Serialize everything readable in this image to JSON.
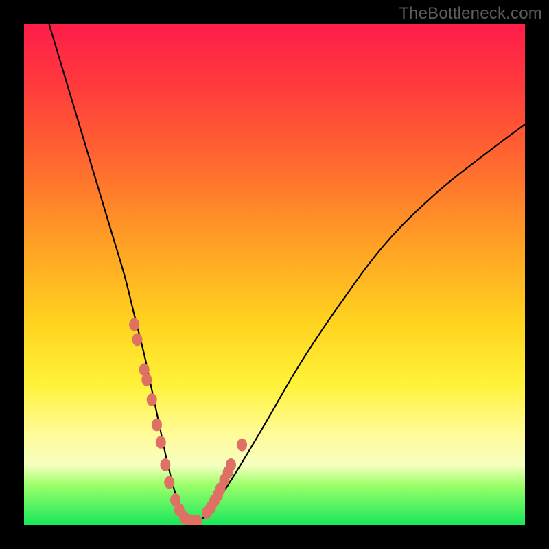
{
  "watermark": "TheBottleneck.com",
  "chart_data": {
    "type": "line",
    "title": "",
    "xlabel": "",
    "ylabel": "",
    "xlim": [
      0,
      100
    ],
    "ylim": [
      0,
      100
    ],
    "grid": false,
    "legend": false,
    "series": [
      {
        "name": "bottleneck-curve",
        "x": [
          5,
          8,
          11,
          14,
          17,
          20,
          22,
          24,
          25.5,
          27,
          28.5,
          30,
          31.5,
          33,
          35,
          38,
          42,
          48,
          55,
          63,
          72,
          82,
          92,
          100
        ],
        "y": [
          100,
          90,
          80,
          70,
          60,
          50,
          42,
          34,
          27,
          20,
          13,
          7,
          3,
          0.8,
          0.8,
          4,
          10,
          20,
          32,
          44,
          56,
          66,
          74,
          80
        ]
      }
    ],
    "markers": {
      "name": "highlight-points",
      "comment": "salmon dots clustered near the minimum region",
      "x": [
        22.0,
        22.6,
        24.0,
        24.5,
        25.5,
        26.5,
        27.3,
        28.2,
        29.0,
        30.2,
        31.0,
        32.0,
        33.2,
        34.5,
        36.5,
        37.3,
        38.0,
        38.7,
        39.2,
        40.0,
        40.7,
        41.3,
        43.5
      ],
      "y": [
        40.0,
        37.0,
        31.0,
        29.0,
        25.0,
        20.0,
        16.5,
        12.0,
        8.5,
        5.0,
        3.0,
        1.5,
        0.8,
        0.8,
        2.5,
        3.5,
        4.8,
        6.0,
        7.2,
        9.0,
        10.5,
        12.0,
        16.0
      ]
    },
    "background_gradient": {
      "top": "#ff1d4a",
      "mid_upper": "#ffa424",
      "mid": "#fff23a",
      "mid_lower": "#f6ffc0",
      "bottom": "#17e85a"
    }
  }
}
